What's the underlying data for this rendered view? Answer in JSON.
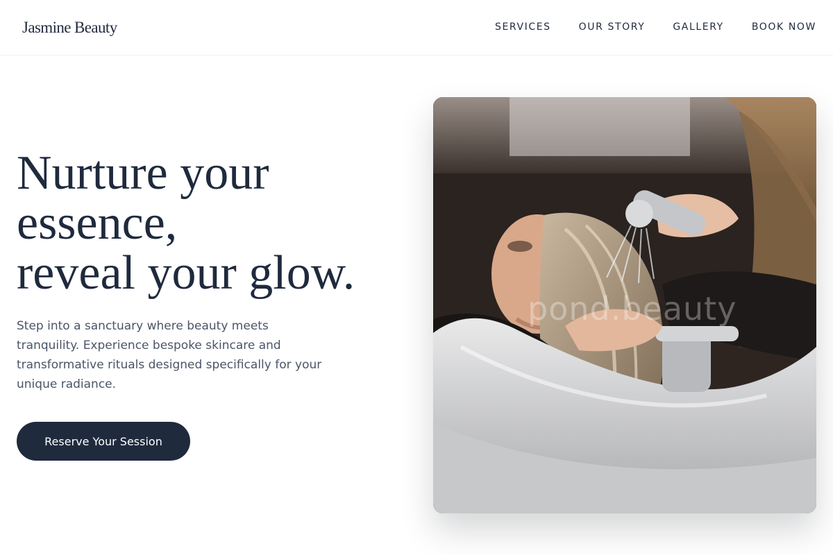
{
  "header": {
    "logo": "Jasmine Beauty",
    "nav": [
      {
        "label": "SERVICES"
      },
      {
        "label": "OUR STORY"
      },
      {
        "label": "GALLERY"
      },
      {
        "label": "BOOK NOW"
      }
    ]
  },
  "hero": {
    "headline_lines": [
      "Nurture your",
      "essence,",
      "reveal your glow."
    ],
    "intro": "Step into a sanctuary where beauty meets tranquility. Experience bespoke skincare and transformative rituals designed specifically for your unique radiance.",
    "cta_label": "Reserve Your Session",
    "image": {
      "watermark": "pond.beauty"
    }
  },
  "colors": {
    "primary": "#1f2a3d",
    "body_text": "#4a5568",
    "background": "#ffffff"
  }
}
